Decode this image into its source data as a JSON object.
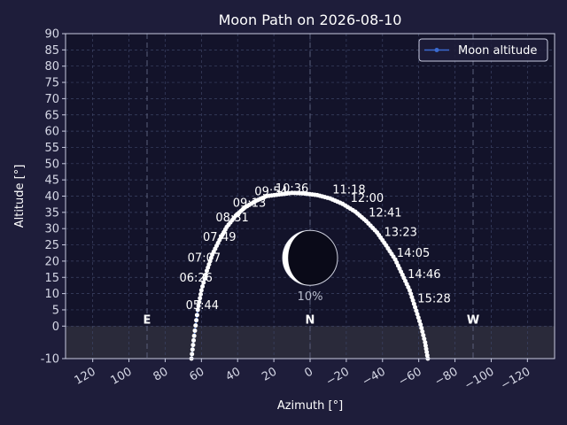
{
  "chart_data": {
    "type": "line",
    "title": "Moon Path on 2026-08-10",
    "xlabel": "Azimuth [°]",
    "ylabel": "Altitude [°]",
    "xlim": [
      135,
      -135
    ],
    "ylim": [
      -10,
      90
    ],
    "x_ticks": [
      120,
      100,
      80,
      60,
      40,
      20,
      0,
      -20,
      -40,
      -60,
      -80,
      -100,
      -120
    ],
    "y_ticks": [
      -10,
      0,
      5,
      10,
      15,
      20,
      25,
      30,
      35,
      40,
      45,
      50,
      55,
      60,
      65,
      70,
      75,
      80,
      85,
      90
    ],
    "grid": true,
    "horizon_shading": [
      -10,
      0
    ],
    "legend": {
      "position": "top-right",
      "entries": [
        "Moon altitude"
      ]
    },
    "colors": {
      "background": "#1e1d3a",
      "plot_background": "#13132a",
      "grid": "#3d4466",
      "line": "#3a6ad0",
      "marker": "#ffffff",
      "horizon_band": "#2a2a3a"
    },
    "series": [
      {
        "name": "Moon altitude",
        "x": [
          65.5,
          64,
          62,
          60,
          57,
          54,
          50,
          46,
          41,
          36,
          30,
          24,
          17,
          10,
          3,
          -4,
          -11,
          -18,
          -25,
          -31,
          -37,
          -42,
          -47,
          -51,
          -55,
          -58,
          -61,
          -63.5,
          -65
        ],
        "y": [
          -10,
          -3,
          5,
          11,
          17,
          22,
          26.5,
          30.5,
          34,
          36.5,
          38.5,
          40,
          40.5,
          41,
          40.8,
          40.3,
          39.3,
          37.6,
          35.2,
          32.3,
          28.8,
          24.8,
          20.5,
          15.8,
          11,
          5.8,
          0.5,
          -5,
          -10
        ]
      }
    ],
    "time_labels": [
      {
        "text": "05:44",
        "x": 59.5,
        "y": 6.5
      },
      {
        "text": "06:26",
        "x": 63,
        "y": 15
      },
      {
        "text": "07:07",
        "x": 58.5,
        "y": 21
      },
      {
        "text": "07:49",
        "x": 50,
        "y": 27.5
      },
      {
        "text": "08:31",
        "x": 43,
        "y": 33.5
      },
      {
        "text": "09:13",
        "x": 33.5,
        "y": 38
      },
      {
        "text": "09:54",
        "x": 21.5,
        "y": 41.5
      },
      {
        "text": "10:36",
        "x": 10,
        "y": 42.5
      },
      {
        "text": "11:18",
        "x": -21.5,
        "y": 42
      },
      {
        "text": "12:00",
        "x": -31.5,
        "y": 39.5
      },
      {
        "text": "12:41",
        "x": -41.5,
        "y": 35
      },
      {
        "text": "13:23",
        "x": -50,
        "y": 29
      },
      {
        "text": "14:05",
        "x": -57,
        "y": 22.5
      },
      {
        "text": "14:46",
        "x": -63,
        "y": 16
      },
      {
        "text": "15:28",
        "x": -68.5,
        "y": 8.5
      }
    ],
    "directions": [
      {
        "text": "E",
        "x": 90,
        "y": 2
      },
      {
        "text": "N",
        "x": 0,
        "y": 2
      },
      {
        "text": "W",
        "x": -90,
        "y": 2
      }
    ],
    "moon_phase": {
      "x": 0,
      "y": 21,
      "illumination_text": "10%",
      "illumination": 0.1
    }
  }
}
